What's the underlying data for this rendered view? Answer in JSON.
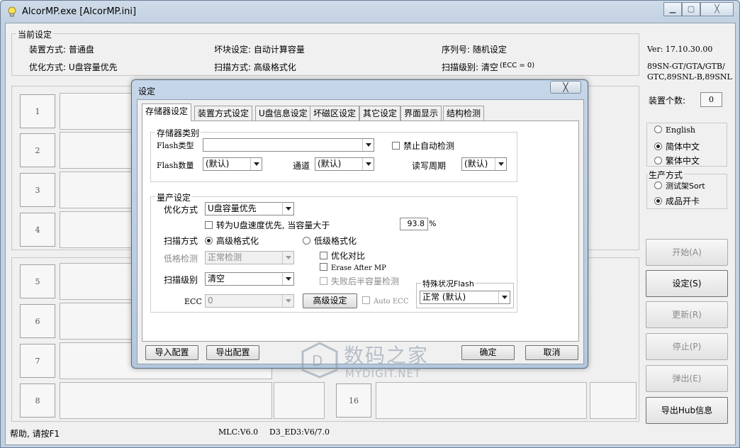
{
  "window": {
    "title": "AlcorMP.exe [AlcorMP.ini]"
  },
  "current_settings": {
    "group_title": "当前设定",
    "mount_mode": "装置方式: 普通盘",
    "bad_block": "坏块设定: 自动计算容量",
    "serial": "序列号: 随机设定",
    "optimize": "优化方式: U盘容量优先",
    "scan_mode": "扫描方式: 高级格式化",
    "scan_level": "扫描级别: 清空",
    "ecc": "(ECC = 0)"
  },
  "version": {
    "label": "Ver: 17.10.30.00",
    "models_line1": "89SN-GT/GTA/GTB/",
    "models_line2": "GTC,89SNL-B,89SNL"
  },
  "device_count": {
    "label": "装置个数:",
    "value": "0"
  },
  "language": {
    "options": [
      "English",
      "简体中文",
      "繁体中文"
    ],
    "selected": "简体中文"
  },
  "production": {
    "title": "生产方式",
    "options": [
      "测试架Sort",
      "成品开卡"
    ],
    "selected": "成品开卡"
  },
  "slots": {
    "left": [
      "1",
      "2",
      "3",
      "4",
      "5",
      "6",
      "7",
      "8"
    ],
    "last": "16"
  },
  "right_buttons": [
    {
      "label": "开始(A)",
      "enabled": false
    },
    {
      "label": "设定(S)",
      "enabled": true
    },
    {
      "label": "更新(R)",
      "enabled": false
    },
    {
      "label": "停止(P)",
      "enabled": false
    },
    {
      "label": "弹出(E)",
      "enabled": false
    },
    {
      "label": "导出Hub信息",
      "enabled": true
    }
  ],
  "status_bar": {
    "help": "帮助, 请按F1",
    "mlc": "MLC:V6.0",
    "d3": "D3_ED3:V6/7.0"
  },
  "dialog": {
    "title": "设定",
    "close": "╳",
    "tabs": [
      "存储器设定",
      "装置方式设定",
      "U盘信息设定",
      "坏磁区设定",
      "其它设定",
      "界面显示",
      "结构检测"
    ],
    "active_tab": "存储器设定",
    "storage_group": {
      "title": "存储器类别",
      "flash_type_label": "Flash类型",
      "flash_type_value": "",
      "disable_autodetect": "禁止自动检测",
      "flash_count_label": "Flash数量",
      "flash_count_value": "(默认)",
      "channel_label": "通道",
      "channel_value": "(默认)",
      "rw_cycle_label": "读写周期",
      "rw_cycle_value": "(默认)"
    },
    "production_group": {
      "title": "量产设定",
      "optimize_label": "优化方式",
      "optimize_value": "U盘容量优先",
      "speed_switch": "转为U盘速度优先, 当容量大于",
      "percent_value": "93.8",
      "percent_unit": "%",
      "scan_mode_label": "扫描方式",
      "scan_advanced": "高级格式化",
      "scan_low": "低级格式化",
      "low_check_label": "低格检测",
      "low_check_value": "正常检测",
      "optimize_compare": "优化对比",
      "erase_after": "Erase After MP",
      "fail_half": "失败后半容量检测",
      "scan_level_label": "扫描级别",
      "scan_level_value": "清空",
      "ecc_label": "ECC",
      "ecc_value": "0",
      "advanced_format_btn": "高级设定",
      "auto_ecc": "Auto ECC",
      "special_flash_title": "特殊状况Flash",
      "special_flash_value": "正常 (默认)"
    },
    "buttons": {
      "import": "导入配置",
      "export": "导出配置",
      "ok": "确定",
      "cancel": "取消"
    }
  },
  "watermark": {
    "main": "数码之家",
    "sub": "MYDIGIT.NET"
  }
}
